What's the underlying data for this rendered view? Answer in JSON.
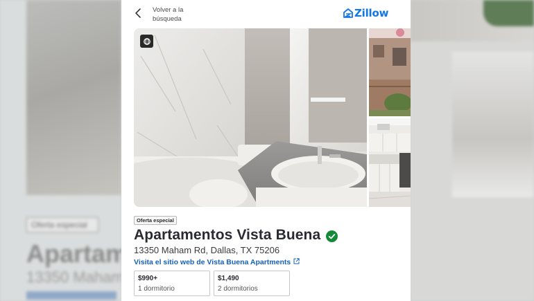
{
  "header": {
    "back_label": "Volver a la búsqueda",
    "logo_text": "Zillow"
  },
  "listing": {
    "badge": "Oferta especial",
    "name": "Apartamentos Vista Buena",
    "address": "13350 Maham Rd, Dallas, TX 75206",
    "website_link": "Visita el sitio web de Vista Buena Apartments"
  },
  "prices": [
    {
      "price": "$990+",
      "beds": "1 dormitorio"
    },
    {
      "price": "$1,490",
      "beds": "2 dormitorios"
    }
  ],
  "background": {
    "badge": "Oferta especial",
    "title": "Apartam",
    "address": "13350 Maham"
  },
  "colors": {
    "brand": "#1277e1",
    "link": "#1761b6",
    "verified": "#138a36"
  },
  "icons": [
    "chevron-left-icon",
    "zillow-logo-icon",
    "3d-tour-icon",
    "verified-check-icon",
    "external-link-icon"
  ]
}
